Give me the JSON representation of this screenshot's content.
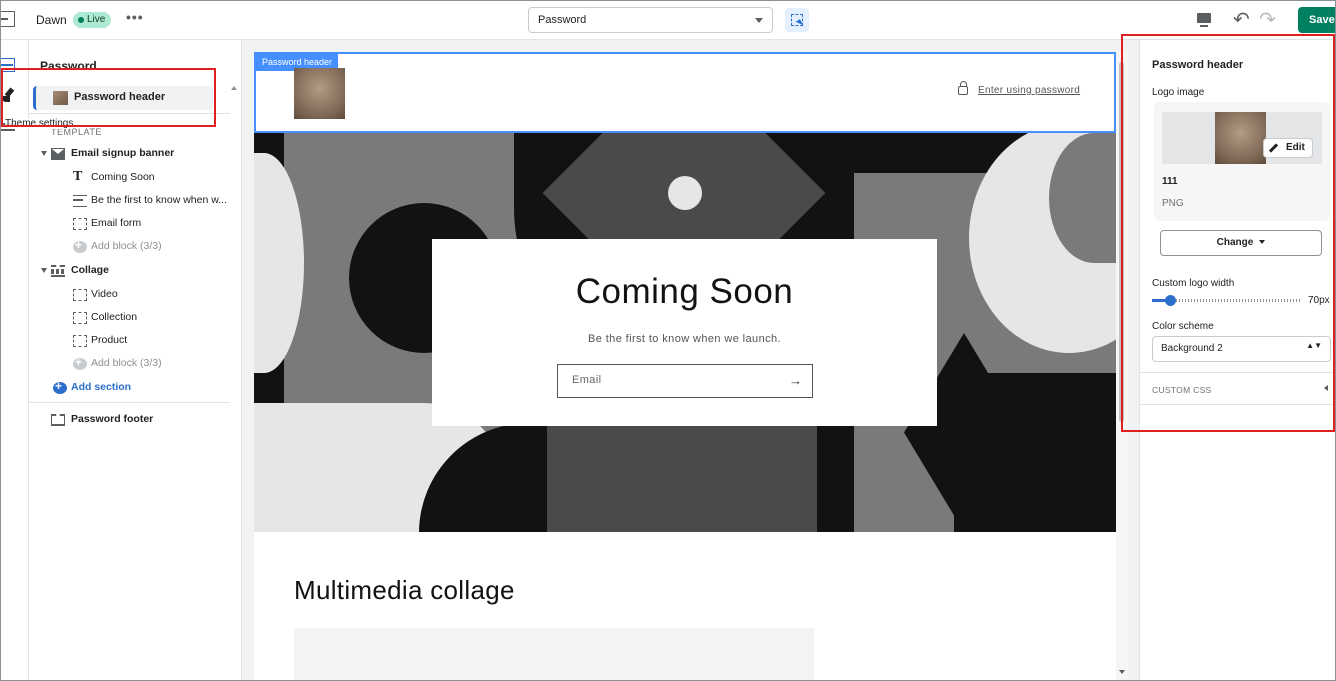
{
  "topbar": {
    "theme_name": "Dawn",
    "status_badge": "Live",
    "more_label": "•••",
    "template_selected": "Password",
    "undo_glyph": "↶",
    "redo_glyph": "↷",
    "save_label": "Save"
  },
  "rail": {
    "tooltip": "Theme settings"
  },
  "sidebar": {
    "title": "Password",
    "header_item": "Password header",
    "template_label": "TEMPLATE",
    "email_signup": {
      "label": "Email signup banner",
      "blocks": [
        "Coming Soon",
        "Be the first to know when w...",
        "Email form"
      ],
      "add_block": "Add block (3/3)"
    },
    "collage": {
      "label": "Collage",
      "blocks": [
        "Video",
        "Collection",
        "Product"
      ],
      "add_block": "Add block (3/3)"
    },
    "add_section": "Add section",
    "footer_item": "Password footer"
  },
  "preview": {
    "header_tag": "Password header",
    "enter_password": "Enter using password",
    "banner_title": "Coming Soon",
    "banner_subtitle": "Be the first to know when we launch.",
    "email_placeholder": "Email",
    "email_arrow": "→",
    "collage_title": "Multimedia collage"
  },
  "settings": {
    "title": "Password header",
    "logo_label": "Logo image",
    "edit_label": "Edit",
    "file_name": "111",
    "file_type": "PNG",
    "change_label": "Change",
    "width_label": "Custom logo width",
    "width_value": "70px",
    "width_fraction": 0.12,
    "scheme_label": "Color scheme",
    "scheme_value": "Background 2",
    "scheme_arrows": "▲▼",
    "custom_css_label": "CUSTOM CSS"
  },
  "colors": {
    "accent_blue": "#2c6ecb",
    "save_green": "#008060",
    "annotation_red": "#e02020",
    "live_badge": "#aee9d1"
  }
}
